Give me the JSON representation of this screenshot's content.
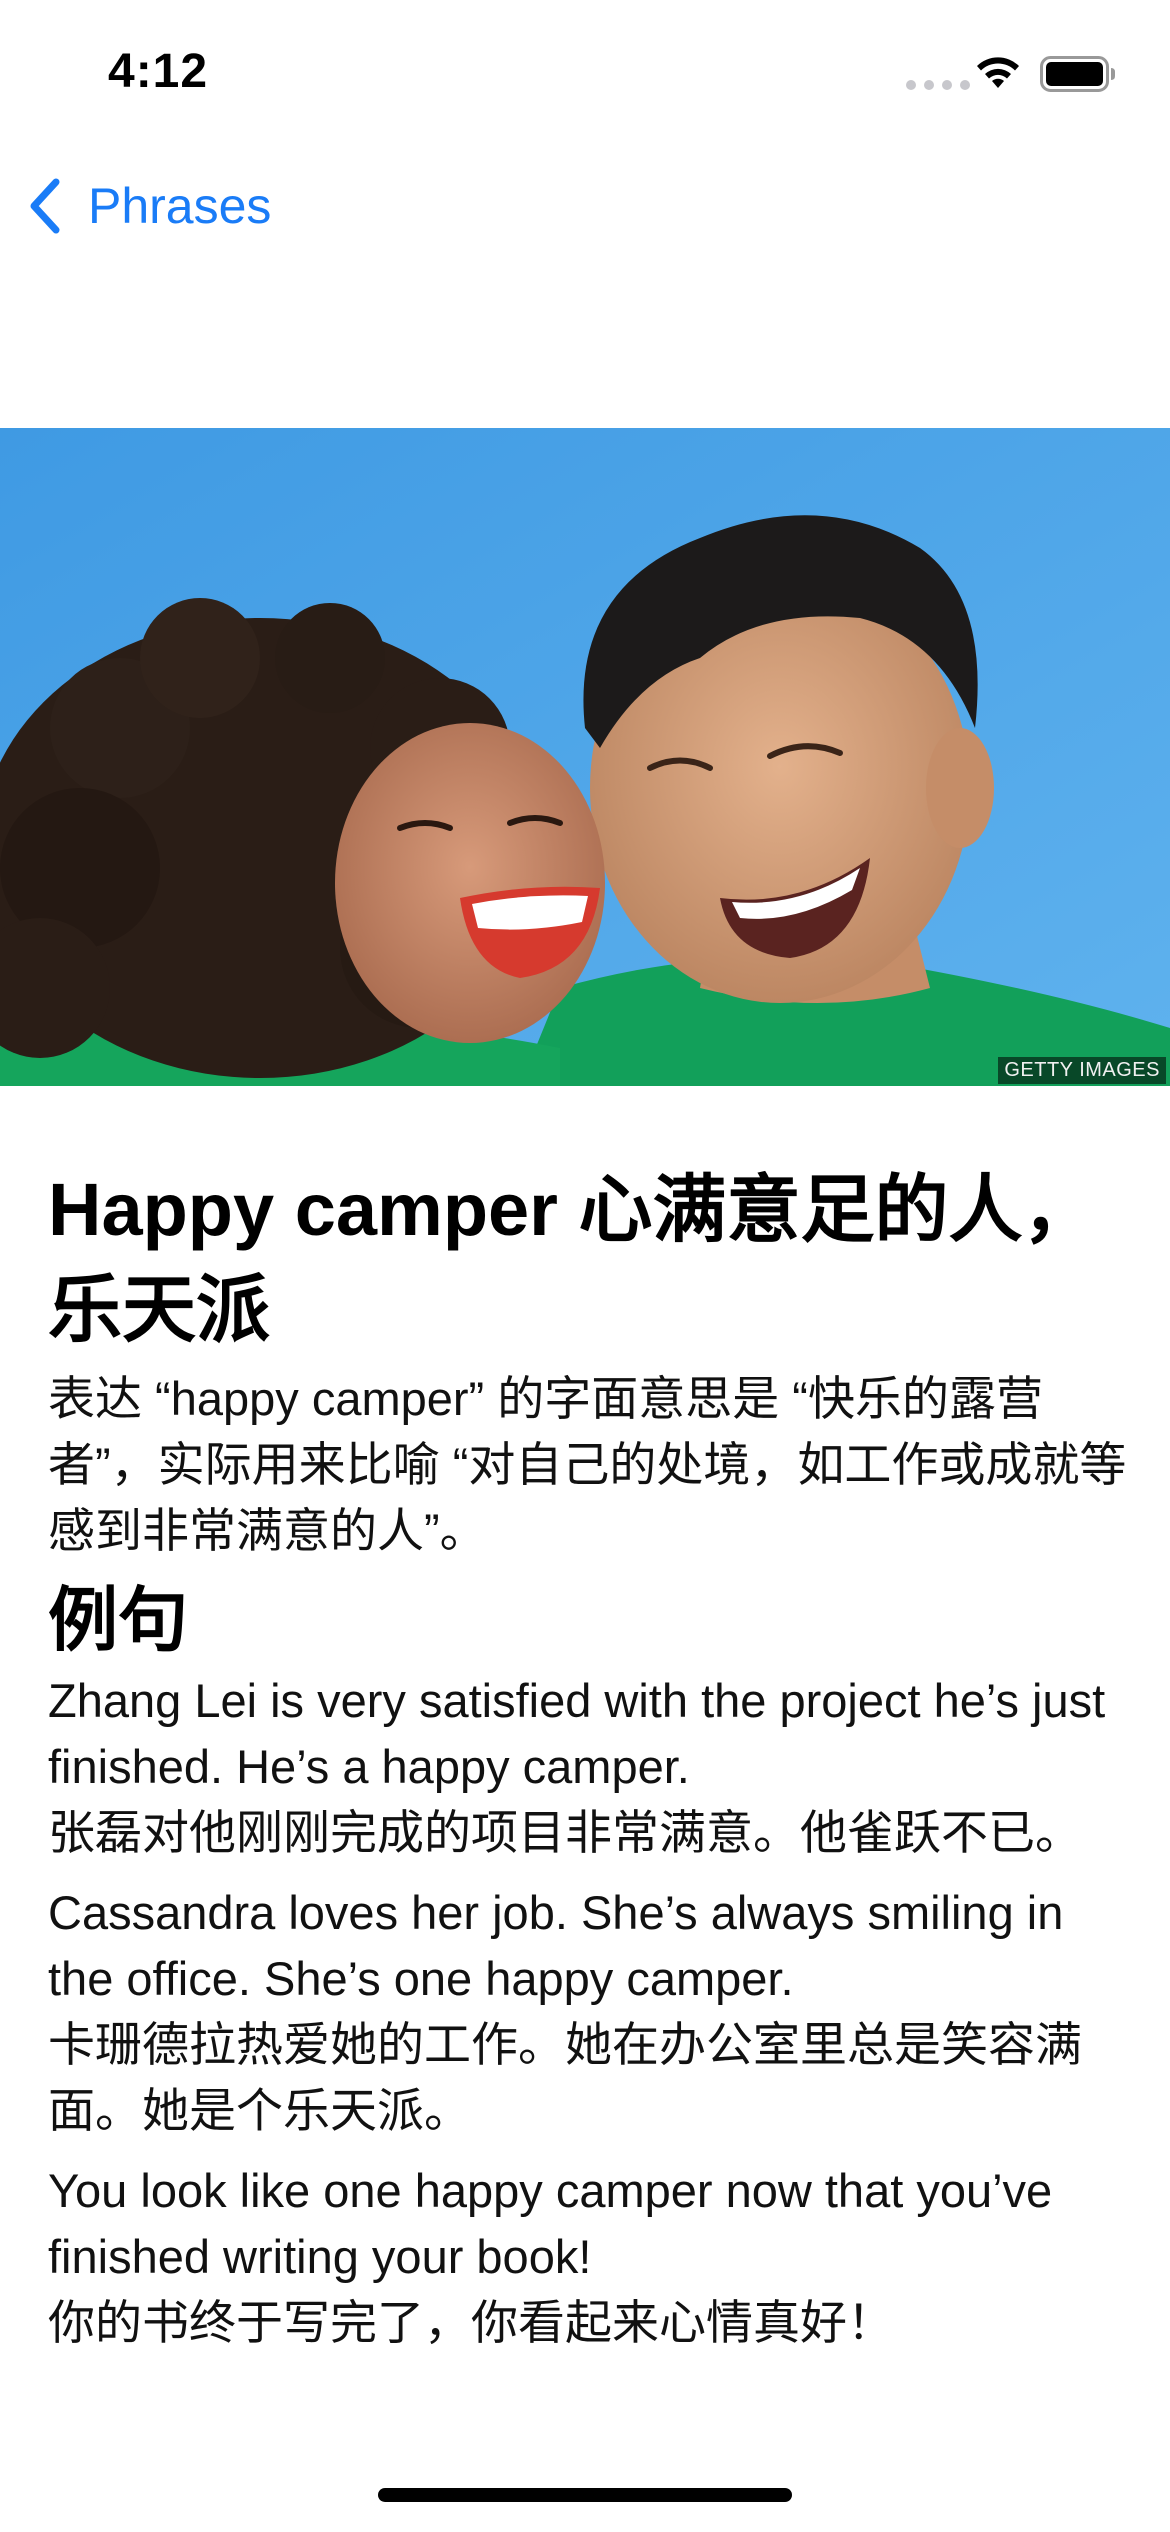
{
  "status_bar": {
    "time": "4:12"
  },
  "nav": {
    "back_label": "Phrases"
  },
  "hero": {
    "credit": "GETTY IMAGES"
  },
  "article": {
    "title": "Happy camper 心满意足的人，乐天派",
    "definition": "表达 “happy camper” 的字面意思是 “快乐的露营者”，实际用来比喻 “对自己的处境，如工作或成就等感到非常满意的人”。",
    "examples_heading": "例句",
    "examples": [
      {
        "english": "Zhang Lei is very satisfied with the project he’s just finished. He’s a happy camper.",
        "chinese": "张磊对他刚刚完成的项目非常满意。他雀跃不已。"
      },
      {
        "english": "Cassandra loves her job. She’s always smiling in the office. She’s one happy camper.",
        "chinese": "卡珊德拉热爱她的工作。她在办公室里总是笑容满面。她是个乐天派。"
      },
      {
        "english": "You look like one happy camper now that you’ve finished writing your book!",
        "chinese": "你的书终于写完了，你看起来心情真好！"
      }
    ]
  },
  "colors": {
    "accent": "#1a7cf7",
    "hero_sky": "#4ba3e6",
    "shirt_green": "#12a05a"
  },
  "icons": [
    "wifi-icon",
    "battery-icon",
    "back-chevron-icon"
  ]
}
